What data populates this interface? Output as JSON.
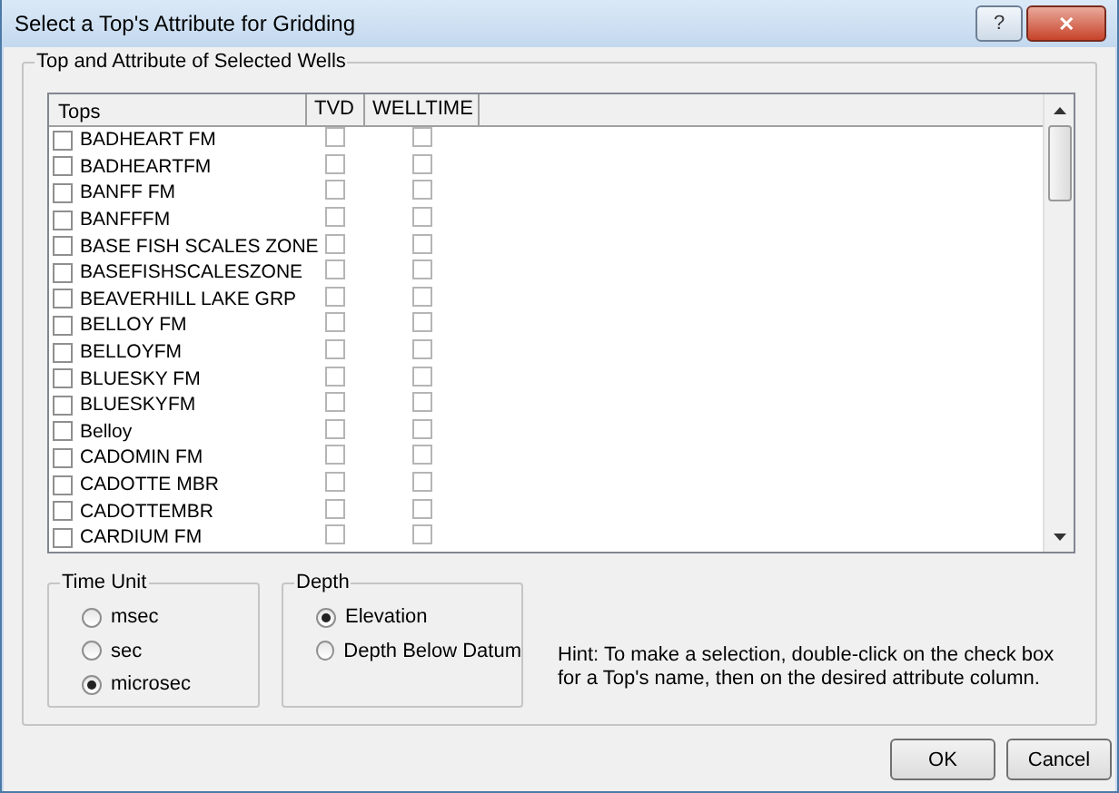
{
  "window": {
    "title": "Select a Top's Attribute for Gridding",
    "buttons": [
      "?",
      "✕"
    ]
  },
  "group_title": "Top and Attribute of Selected Wells",
  "columns": [
    "Tops",
    "TVD",
    "WELLTIME"
  ],
  "tops": [
    {
      "name": "BADHEART FM",
      "checked": false,
      "tvd": false,
      "welltime": false
    },
    {
      "name": "BADHEARTFM",
      "checked": false,
      "tvd": false,
      "welltime": false
    },
    {
      "name": "BANFF FM",
      "checked": false,
      "tvd": false,
      "welltime": false
    },
    {
      "name": "BANFFFM",
      "checked": false,
      "tvd": false,
      "welltime": false
    },
    {
      "name": "BASE FISH SCALES ZONE",
      "checked": false,
      "tvd": false,
      "welltime": false
    },
    {
      "name": "BASEFISHSCALESZONE",
      "checked": false,
      "tvd": false,
      "welltime": false
    },
    {
      "name": "BEAVERHILL LAKE GRP",
      "checked": false,
      "tvd": false,
      "welltime": false
    },
    {
      "name": "BELLOY FM",
      "checked": false,
      "tvd": false,
      "welltime": false
    },
    {
      "name": "BELLOYFM",
      "checked": false,
      "tvd": false,
      "welltime": false
    },
    {
      "name": "BLUESKY FM",
      "checked": false,
      "tvd": false,
      "welltime": false
    },
    {
      "name": "BLUESKYFM",
      "checked": false,
      "tvd": false,
      "welltime": false
    },
    {
      "name": "Belloy",
      "checked": false,
      "tvd": false,
      "welltime": false
    },
    {
      "name": "CADOMIN FM",
      "checked": false,
      "tvd": false,
      "welltime": false
    },
    {
      "name": "CADOTTE MBR",
      "checked": false,
      "tvd": false,
      "welltime": false
    },
    {
      "name": "CADOTTEMBR",
      "checked": false,
      "tvd": false,
      "welltime": false
    },
    {
      "name": "CARDIUM FM",
      "checked": false,
      "tvd": false,
      "welltime": false
    }
  ],
  "time_unit": {
    "title": "Time Unit",
    "options": [
      {
        "label": "msec",
        "selected": false
      },
      {
        "label": "sec",
        "selected": false
      },
      {
        "label": "microsec",
        "selected": true
      }
    ]
  },
  "depth": {
    "title": "Depth",
    "options": [
      {
        "label": "Elevation",
        "selected": true
      },
      {
        "label": "Depth Below Datum",
        "selected": false
      }
    ]
  },
  "hint": "Hint: To make a selection, double-click on the check box for a Top's name, then on the desired attribute column.",
  "buttons": [
    "OK",
    "Cancel"
  ]
}
